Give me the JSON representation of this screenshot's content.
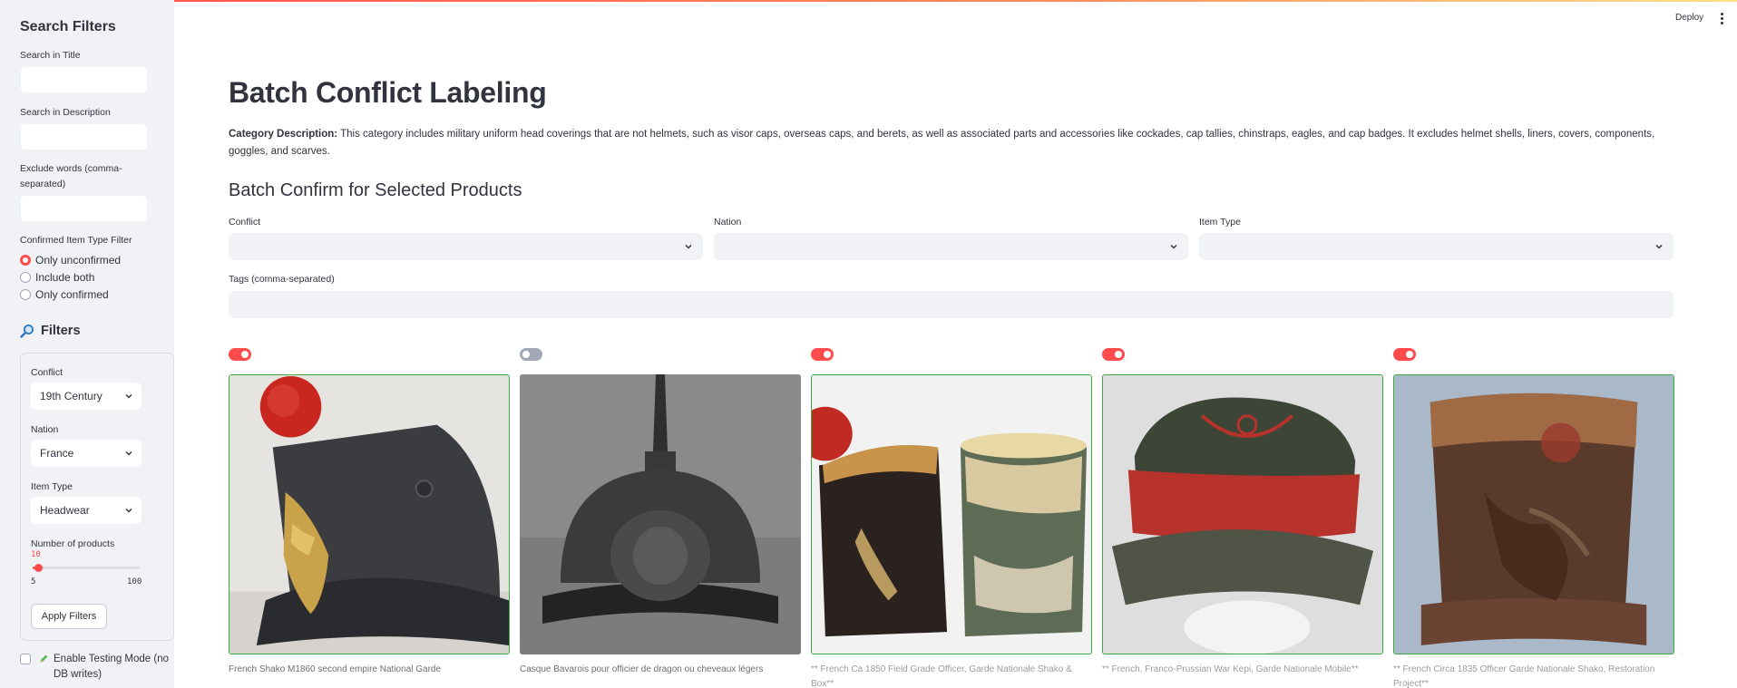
{
  "header": {
    "deploy_label": "Deploy"
  },
  "sidebar": {
    "title": "Search Filters",
    "search_title_label": "Search in Title",
    "search_title_value": "",
    "search_desc_label": "Search in Description",
    "search_desc_value": "",
    "exclude_label": "Exclude words (comma-separated)",
    "exclude_value": "",
    "confirmed_filter_label": "Confirmed Item Type Filter",
    "confirmed_options": [
      "Only unconfirmed",
      "Include both",
      "Only confirmed"
    ],
    "confirmed_selected": "Only unconfirmed",
    "filters_title": "Filters",
    "filters_icon": "magnifier-icon",
    "conflict_label": "Conflict",
    "conflict_value": "19th Century",
    "nation_label": "Nation",
    "nation_value": "France",
    "item_type_label": "Item Type",
    "item_type_value": "Headwear",
    "num_products_label": "Number of products",
    "num_products_value": "10",
    "num_products_min": "5",
    "num_products_max": "100",
    "apply_label": "Apply Filters",
    "testing_label": "Enable Testing Mode (no DB writes)",
    "testing_checked": false,
    "testing_icon": "pencil-icon"
  },
  "main": {
    "title": "Batch Conflict Labeling",
    "category_prefix": "Category Description:",
    "category_text": " This category includes military uniform head coverings that are not helmets, such as visor caps, overseas caps, and berets, as well as associated parts and accessories like cockades, cap tallies, chinstraps, eagles, and cap badges. It excludes helmet shells, liners, covers, components, goggles, and scarves.",
    "batch_title": "Batch Confirm for Selected Products",
    "conflict_label": "Conflict",
    "conflict_value": "",
    "nation_label": "Nation",
    "nation_value": "",
    "item_type_label": "Item Type",
    "item_type_value": "",
    "tags_label": "Tags (comma-separated)",
    "tags_value": ""
  },
  "products": [
    {
      "selected": true,
      "caption": "French Shako M1860 second empire National Garde"
    },
    {
      "selected": false,
      "caption": "Casque Bavarois pour officier de dragon ou cheveaux légers"
    },
    {
      "selected": true,
      "caption": "** French Ca 1850 Field Grade Officer, Garde Nationale Shako & Box**"
    },
    {
      "selected": true,
      "caption": "** French, Franco-Prussian War Kepi, Garde Nationale Mobile**"
    },
    {
      "selected": true,
      "caption": "** French Circa 1835 Officer Garde Nationale Shako, Restoration Project**"
    }
  ],
  "colors": {
    "accent": "#ff4b4b",
    "selected_border": "#3aa83a",
    "sidebar_bg": "#f0f2f6",
    "input_bg": "#f0f2f6"
  }
}
